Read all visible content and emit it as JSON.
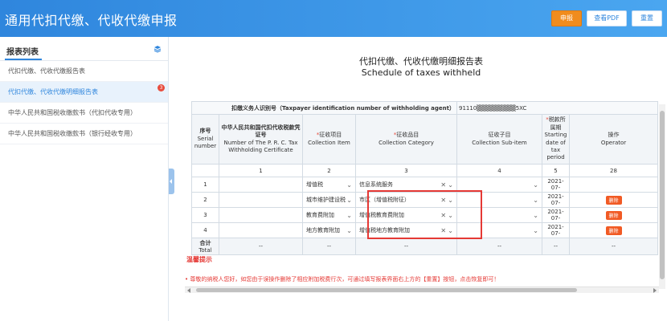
{
  "app": {
    "title": "通用代扣代缴、代收代缴申报"
  },
  "toolbar": {
    "declare_label": "申报",
    "pdf_label": "查看PDF",
    "reset_label": "重置"
  },
  "sidebar": {
    "title": "报表列表",
    "items": [
      {
        "label": "代扣代缴、代收代缴报告表"
      },
      {
        "label": "代扣代缴、代收代缴明细报告表",
        "badge": "3"
      },
      {
        "label": "中华人民共和国税收缴款书（代扣代收专用）"
      },
      {
        "label": "中华人民共和国税收缴款书（银行经收专用）"
      }
    ]
  },
  "document": {
    "title_cn": "代扣代缴、代收代缴明细报告表",
    "title_en": "Schedule of taxes withheld",
    "agent_label": "扣缴义务人识别号（Taxpayer identification number of withholding agent）",
    "agent_value": "91110▒▒▒▒▒▒▒▒▒5XC"
  },
  "table": {
    "headers": {
      "serial": {
        "cn": "序号",
        "en": "Serial number"
      },
      "certificate": {
        "cn": "中华人民共和国代扣代收税款凭证号",
        "en": "Number of The P. R. C. Tax Withholding Certificate"
      },
      "item": {
        "cn": "征收项目",
        "en": "Collection Item",
        "required": "*"
      },
      "category": {
        "cn": "征收品目",
        "en": "Collection Category",
        "required": "*"
      },
      "subitem": {
        "cn": "征收子目",
        "en": "Collection Sub-item"
      },
      "start_date": {
        "cn": "税款所属期",
        "en": "Starting date of tax period",
        "required": "*"
      },
      "operator": {
        "cn": "操作",
        "en": "Operator"
      }
    },
    "index_row": [
      "1",
      "2",
      "3",
      "4",
      "5",
      "28"
    ],
    "rows": [
      {
        "serial": "1",
        "item": "增值税",
        "category": "信息系统服务",
        "start": "2021-07-",
        "delete": ""
      },
      {
        "serial": "2",
        "item": "城市维护建设税",
        "category": "市区（增值税附征）",
        "start": "2021-07-",
        "delete": "删除"
      },
      {
        "serial": "3",
        "item": "教育费附加",
        "category": "增值税教育费附加",
        "start": "2021-07-",
        "delete": "删除"
      },
      {
        "serial": "4",
        "item": "地方教育附加",
        "category": "增值税地方教育附加",
        "start": "2021-07-",
        "delete": "删除"
      }
    ],
    "total": {
      "label_cn": "合计",
      "label_en": "Total",
      "placeholder": "--"
    }
  },
  "tips": {
    "title": "温馨提示",
    "message": "• 尊敬的纳税人您好，如您由于误操作删除了相应附加税费行次，可通过填写报表界面右上方的【重置】按钮，点击恢复即可！"
  },
  "colors": {
    "topbar": "#2f86dd",
    "accent_orange": "#f08c1e",
    "alert_red": "#e53935"
  }
}
